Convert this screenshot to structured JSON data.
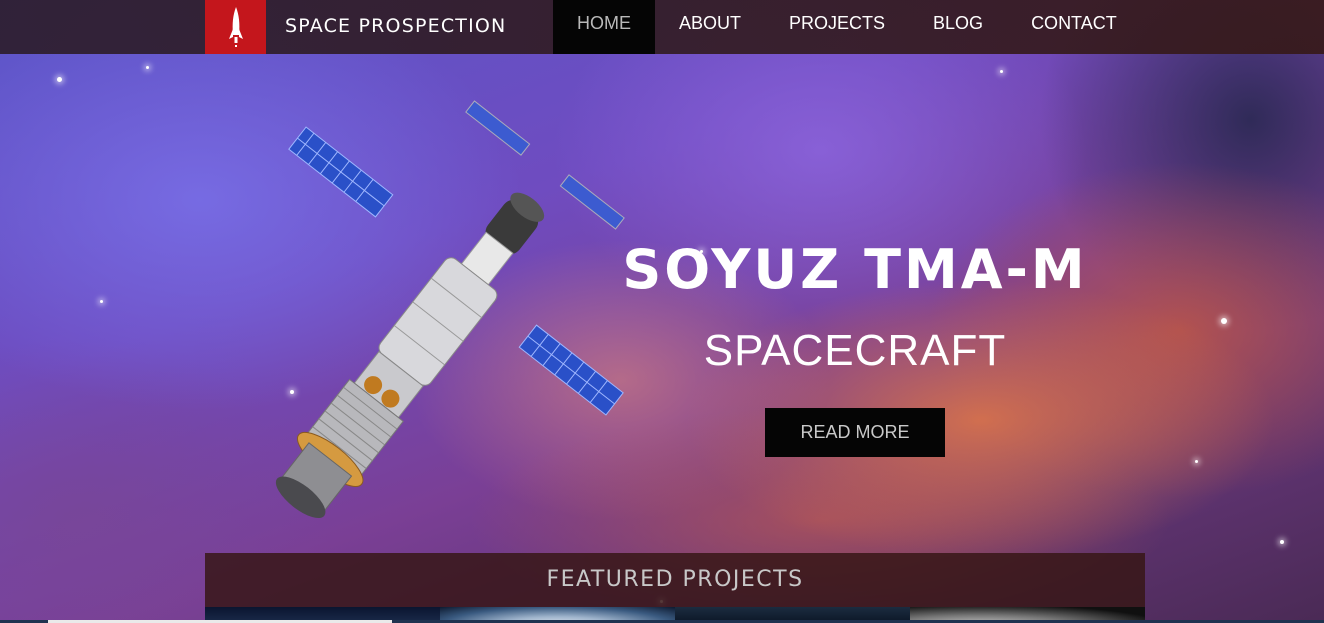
{
  "header": {
    "brand": "SPACE PROSPECTION",
    "logo_icon": "rocket-icon",
    "nav": [
      {
        "label": "HOME",
        "active": true
      },
      {
        "label": "ABOUT",
        "active": false
      },
      {
        "label": "PROJECTS",
        "active": false
      },
      {
        "label": "BLOG",
        "active": false
      },
      {
        "label": "CONTACT",
        "active": false
      }
    ]
  },
  "hero": {
    "title": "SOYUZ TMA-M",
    "subtitle": "SPACECRAFT",
    "button_label": "READ MORE",
    "image": "spacecraft-image"
  },
  "featured": {
    "title": "FEATURED PROJECTS"
  },
  "colors": {
    "logo_red": "#c4161c",
    "nav_active_bg": "#050505",
    "button_bg": "#050505"
  }
}
